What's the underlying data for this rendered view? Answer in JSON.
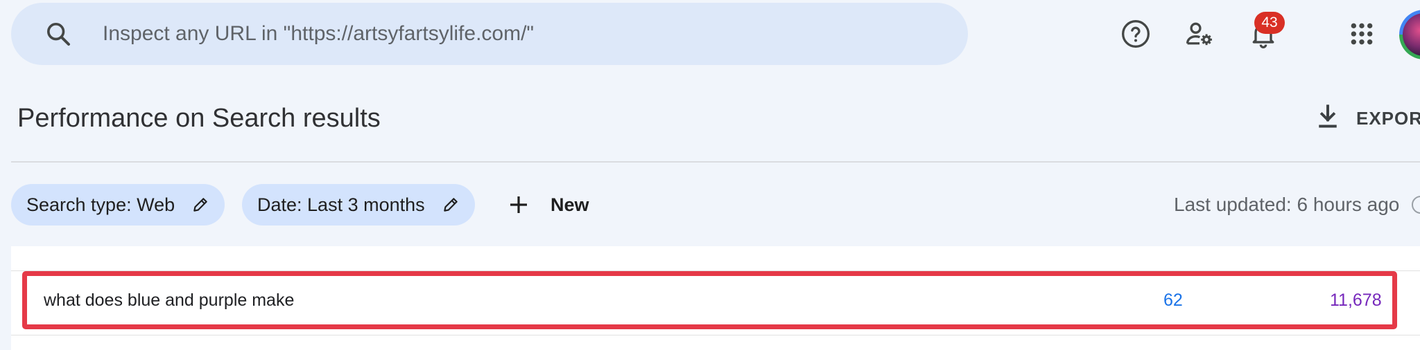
{
  "search": {
    "placeholder": "Inspect any URL in \"https://artsyfartsylife.com/\""
  },
  "header": {
    "icons": [
      "help-icon",
      "manage-users-icon",
      "notifications-icon",
      "apps-grid-icon"
    ],
    "notification_count": "43"
  },
  "page": {
    "title": "Performance on Search results",
    "export_label": "EXPORT"
  },
  "filters": {
    "chips": [
      {
        "label": "Search type: Web"
      },
      {
        "label": "Date: Last 3 months"
      }
    ],
    "new_label": "New",
    "last_updated": "Last updated: 6 hours ago"
  },
  "table": {
    "rows": [
      {
        "query": "what does blue and purple make",
        "clicks": "62",
        "impressions": "11,678"
      }
    ]
  },
  "colors": {
    "accent_blue": "#1a73e8",
    "impressions_purple": "#7627bb",
    "highlight_red": "#e53947",
    "badge_red": "#d93025"
  }
}
